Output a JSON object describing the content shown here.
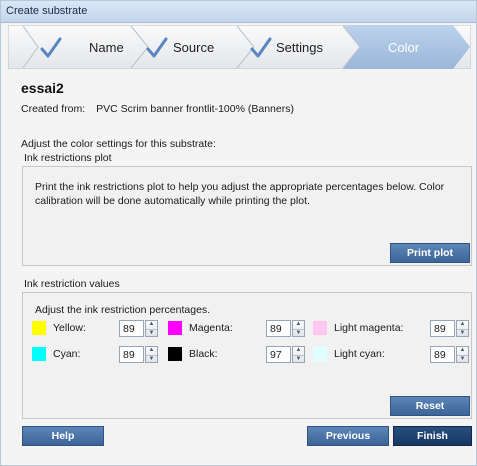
{
  "window": {
    "title": "Create substrate"
  },
  "steps": [
    {
      "label": "Name",
      "done": true
    },
    {
      "label": "Source",
      "done": true
    },
    {
      "label": "Settings",
      "done": true
    },
    {
      "label": "Color",
      "active": true
    }
  ],
  "substrate": {
    "name": "essai2",
    "created_from_label": "Created from:",
    "created_from_value": "PVC Scrim banner frontlit-100% (Banners)"
  },
  "adjust_text": "Adjust the color settings for this substrate:",
  "ink_plot": {
    "section_title": "Ink restrictions plot",
    "description": "Print the ink restrictions plot to help you adjust the appropriate percentages below. Color calibration will be done automatically while printing the plot.",
    "print_button": "Print plot"
  },
  "ink_values": {
    "section_title": "Ink restriction values",
    "hint": "Adjust the ink restriction percentages.",
    "inks": [
      {
        "name": "Yellow:",
        "value": "89",
        "color": "#ffff00"
      },
      {
        "name": "Cyan:",
        "value": "89",
        "color": "#00ffff"
      },
      {
        "name": "Magenta:",
        "value": "89",
        "color": "#ff00ff"
      },
      {
        "name": "Black:",
        "value": "97",
        "color": "#000000"
      },
      {
        "name": "Light magenta:",
        "value": "89",
        "color": "#ffc8f0"
      },
      {
        "name": "Light cyan:",
        "value": "89",
        "color": "#e2ffff"
      }
    ],
    "reset_button": "Reset"
  },
  "footer": {
    "help": "Help",
    "previous": "Previous",
    "finish": "Finish"
  },
  "colors": {
    "accent": "#3b6497",
    "step_active": "#a7c1e0",
    "check": "#5a86c4"
  }
}
